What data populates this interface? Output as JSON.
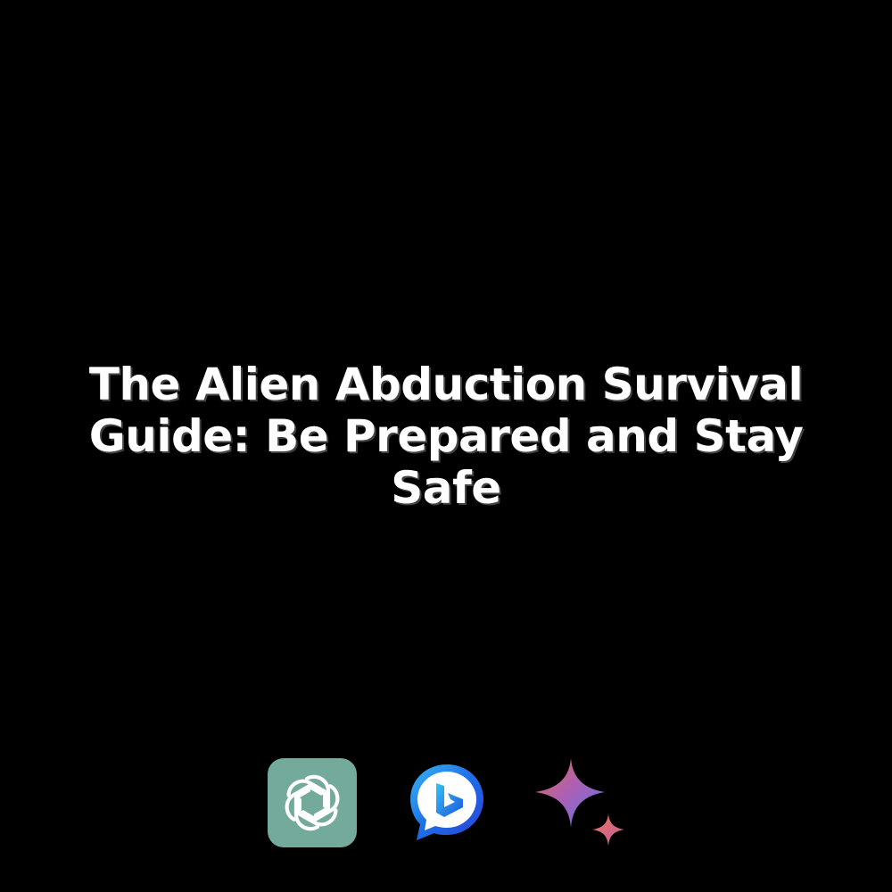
{
  "title": "The Alien Abduction Survival Guide: Be Prepared and Stay Safe",
  "background_color": "#000000",
  "text_color": "#ffffff",
  "icons": [
    {
      "name": "openai-chatgpt-logo-icon",
      "color": "#74aa9c"
    },
    {
      "name": "bing-chat-logo-icon",
      "color": "#1e6ee8"
    },
    {
      "name": "gemini-sparkle-logo-icon",
      "color": "#c75b9b"
    }
  ]
}
